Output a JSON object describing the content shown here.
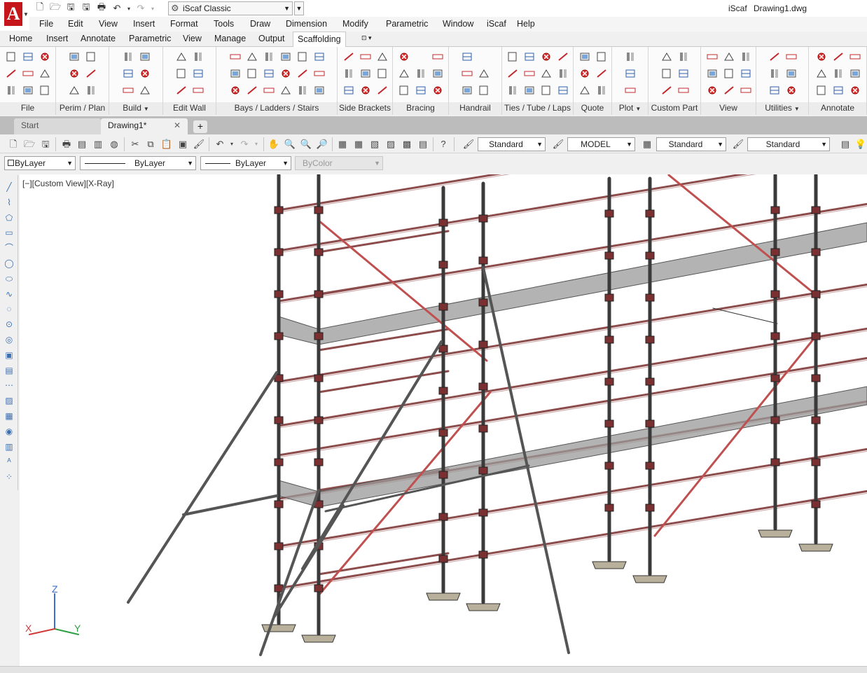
{
  "titlebar": {
    "app_name": "iScaf",
    "file_name": "Drawing1.dwg",
    "workspace": "iScaf Classic",
    "app_letter": "A"
  },
  "menu": [
    "File",
    "Edit",
    "View",
    "Insert",
    "Format",
    "Tools",
    "Draw",
    "Dimension",
    "Modify",
    "Parametric",
    "Window",
    "iScaf",
    "Help"
  ],
  "ribbon_tabs": [
    "Home",
    "Insert",
    "Annotate",
    "Parametric",
    "View",
    "Manage",
    "Output",
    "Scaffolding"
  ],
  "active_ribbon_tab": "Scaffolding",
  "ribbon_panels": [
    {
      "label": "File",
      "dropdown": false
    },
    {
      "label": "Perim / Plan",
      "dropdown": false
    },
    {
      "label": "Build",
      "dropdown": true
    },
    {
      "label": "Edit Wall",
      "dropdown": false
    },
    {
      "label": "Bays /  Ladders / Stairs",
      "dropdown": false
    },
    {
      "label": "Side Brackets",
      "dropdown": false
    },
    {
      "label": "Bracing",
      "dropdown": false
    },
    {
      "label": "Handrail",
      "dropdown": false
    },
    {
      "label": "Ties / Tube / Laps",
      "dropdown": false
    },
    {
      "label": "Quote",
      "dropdown": false
    },
    {
      "label": "Plot",
      "dropdown": true
    },
    {
      "label": "Custom Part",
      "dropdown": false
    },
    {
      "label": "View",
      "dropdown": false
    },
    {
      "label": "Utilities",
      "dropdown": true
    },
    {
      "label": "Annotate",
      "dropdown": false
    }
  ],
  "doc_tabs": {
    "start": "Start",
    "drawing": "Drawing1*",
    "close": "✕",
    "add": "+"
  },
  "standard_toolbar": {
    "text_style": "Standard",
    "dim_style": "MODEL",
    "table_style": "Standard",
    "multileader_style": "Standard"
  },
  "properties": {
    "layer": "ByLayer",
    "linetype": "ByLayer",
    "lineweight": "ByLayer",
    "plotstyle": "ByColor"
  },
  "viewport": {
    "label": "[−][Custom View][X-Ray]",
    "ucs_x": "X",
    "ucs_y": "Y",
    "ucs_z": "Z"
  },
  "colors": {
    "app_red": "#c5161b",
    "tube_dark": "#3a3a3a",
    "ledger_red": "#8c4c4c",
    "brace_red": "#c05050",
    "board_grey": "#7a7a7a"
  },
  "icons": {
    "workspace": "gear-icon",
    "dropdown": "chevron-down-icon",
    "close": "close-icon"
  }
}
